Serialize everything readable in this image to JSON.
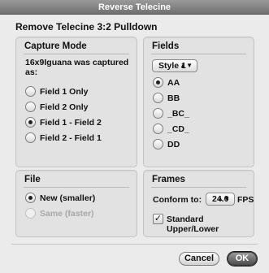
{
  "window": {
    "title": "Reverse Telecine"
  },
  "dialog": {
    "heading": "Remove Telecine 3:2 Pulldown"
  },
  "capture_mode": {
    "title": "Capture Mode",
    "description": "16x9Iguana was captured as:",
    "options": [
      "Field 1 Only",
      "Field 2 Only",
      "Field 1 - Field 2",
      "Field 2 - Field 1"
    ],
    "selected": "Field 1 - Field 2"
  },
  "fields": {
    "title": "Fields",
    "style_value": "Style 1",
    "options": [
      "AA",
      "BB",
      "_BC_",
      "_CD_",
      "DD"
    ],
    "selected": "AA"
  },
  "file": {
    "title": "File",
    "options": [
      "New (smaller)",
      "Same (faster)"
    ],
    "selected": "New (smaller)"
  },
  "frames": {
    "title": "Frames",
    "conform_label": "Conform to:",
    "conform_value": "24.0",
    "fps_label": "FPS",
    "standard_label": "Standard Upper/Lower",
    "standard_checked": true
  },
  "buttons": {
    "cancel": "Cancel",
    "ok": "OK"
  }
}
